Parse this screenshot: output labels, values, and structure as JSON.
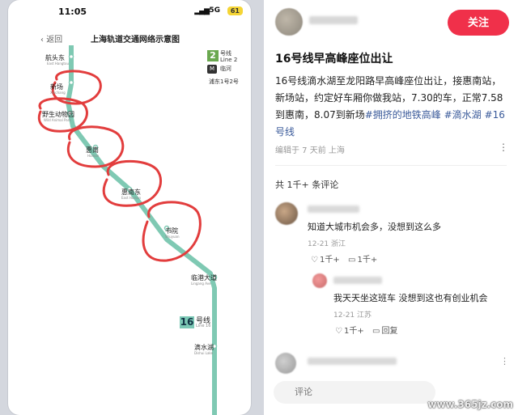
{
  "phone": {
    "status": {
      "time": "11:05",
      "network": "5G",
      "battery": "61"
    },
    "nav": {
      "back_label": "返回",
      "title": "上海轨道交通网络示意图"
    },
    "map": {
      "line_colors": {
        "line16": "#7fc9b3",
        "line2": "#6aa84f",
        "annotation": "#e23d3d"
      },
      "stations": [
        {
          "name": "航头东",
          "en": "East Hangtou"
        },
        {
          "name": "新场",
          "en": "Xinchang"
        },
        {
          "name": "野生动物园",
          "en": "Wild Animal Park"
        },
        {
          "name": "惠南",
          "en": "Huinan"
        },
        {
          "name": "惠南东",
          "en": "East Huinan"
        },
        {
          "name": "书院",
          "en": "Shuyuan"
        },
        {
          "name": "临港大道",
          "en": "Lingang Ave"
        },
        {
          "name": "滴水湖",
          "en": "Dishui Lake"
        }
      ],
      "line2_badge": {
        "number": "2",
        "label": "号线",
        "sub": "Line 2"
      },
      "linghu_label": "临河",
      "pudong_label": "浦东1号2号",
      "line16_badge": {
        "number": "16",
        "label": "号线",
        "sub": "Line 16"
      }
    }
  },
  "post": {
    "follow_label": "关注",
    "title": "16号线早高峰座位出让",
    "body": "16号线滴水湖至龙阳路早高峰座位出让，接惠南站，新场站，约定好车厢你做我站，7.30的车，正常7.58到惠南，8.07到新场",
    "tags": [
      "#拥挤的地铁高峰",
      "#滴水湖",
      "#16号线"
    ],
    "meta": "编辑于 7 天前 上海",
    "comments_count": "共 1千+ 条评论"
  },
  "comments": [
    {
      "text": "知道大城市机会多，没想到这么多",
      "meta": "12-21 浙江",
      "likes": "1千+",
      "replies": "1千+"
    },
    {
      "text": "我天天坐这班车 没想到这也有创业机会",
      "meta": "12-21 江苏",
      "likes": "1千+",
      "reply_label": "回复"
    }
  ],
  "bottom": {
    "placeholder": "评论"
  },
  "watermark": "www.365jz.com"
}
